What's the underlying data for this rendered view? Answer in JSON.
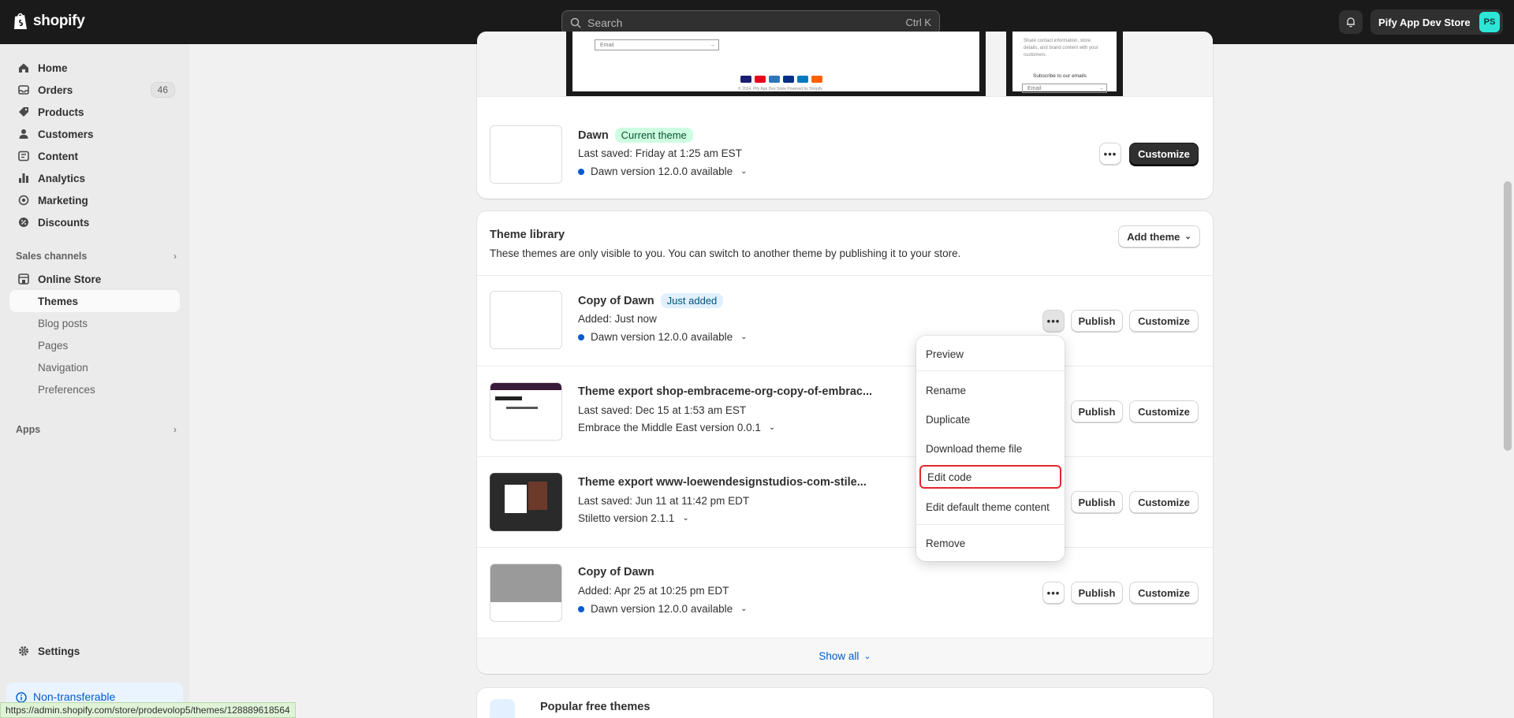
{
  "topbar": {
    "brand": "shopify",
    "search_placeholder": "Search",
    "search_shortcut": "Ctrl K",
    "store_name": "Pify App Dev Store",
    "avatar_initials": "PS"
  },
  "sidebar": {
    "items": [
      {
        "label": "Home",
        "icon": "home-icon"
      },
      {
        "label": "Orders",
        "icon": "orders-icon",
        "count": "46"
      },
      {
        "label": "Products",
        "icon": "tag-icon"
      },
      {
        "label": "Customers",
        "icon": "person-icon"
      },
      {
        "label": "Content",
        "icon": "content-icon"
      },
      {
        "label": "Analytics",
        "icon": "bar-chart-icon"
      },
      {
        "label": "Marketing",
        "icon": "target-icon"
      },
      {
        "label": "Discounts",
        "icon": "discount-icon"
      }
    ],
    "sales_channels_label": "Sales channels",
    "online_store": "Online Store",
    "online_store_sub": [
      "Themes",
      "Blog posts",
      "Pages",
      "Navigation",
      "Preferences"
    ],
    "apps_label": "Apps",
    "settings_label": "Settings",
    "nontransferable_label": "Non-transferable"
  },
  "status_url": "https://admin.shopify.com/store/prodevolop5/themes/128889618564",
  "current_theme": {
    "preview_email_label": "Email",
    "preview_mobile_text": "Share contact information, store details, and brand content with your customers.",
    "preview_mobile_subscribe": "Subscribe to our emails",
    "preview_footer": "© 2024, Pify App Dev Store Powered by Shopify",
    "name": "Dawn",
    "badge": "Current theme",
    "saved": "Last saved: Friday at 1:25 am EST",
    "version": "Dawn version 12.0.0 available",
    "customize_label": "Customize"
  },
  "library": {
    "title": "Theme library",
    "subtitle": "These themes are only visible to you. You can switch to another theme by publishing it to your store.",
    "add_theme_label": "Add theme",
    "publish_label": "Publish",
    "customize_label": "Customize",
    "show_all_label": "Show all",
    "themes": [
      {
        "name": "Copy of Dawn",
        "badge": "Just added",
        "meta": "Added: Just now",
        "version": "Dawn version 12.0.0 available",
        "has_dot": true
      },
      {
        "name": "Theme export shop-embraceme-org-copy-of-embrac...",
        "meta": "Last saved: Dec 15 at 1:53 am EST",
        "version": "Embrace the Middle East version 0.0.1",
        "has_dot": false
      },
      {
        "name": "Theme export www-loewendesignstudios-com-stile...",
        "meta": "Last saved: Jun 11 at 11:42 pm EDT",
        "version": "Stiletto version 2.1.1",
        "has_dot": false
      },
      {
        "name": "Copy of Dawn",
        "meta": "Added: Apr 25 at 10:25 pm EDT",
        "version": "Dawn version 12.0.0 available",
        "has_dot": true
      }
    ]
  },
  "menu": {
    "items": [
      "Preview",
      "Rename",
      "Duplicate",
      "Download theme file",
      "Edit code",
      "Edit default theme content",
      "Remove"
    ],
    "highlighted": "Edit code"
  },
  "popular": {
    "title": "Popular free themes"
  },
  "colors": {
    "topbar": "#1a1a1a",
    "accent_blue": "#005bd3",
    "highlight_red": "#e0282e",
    "current_badge": "#cdfee1",
    "just_added_badge": "#e0f0ff"
  }
}
